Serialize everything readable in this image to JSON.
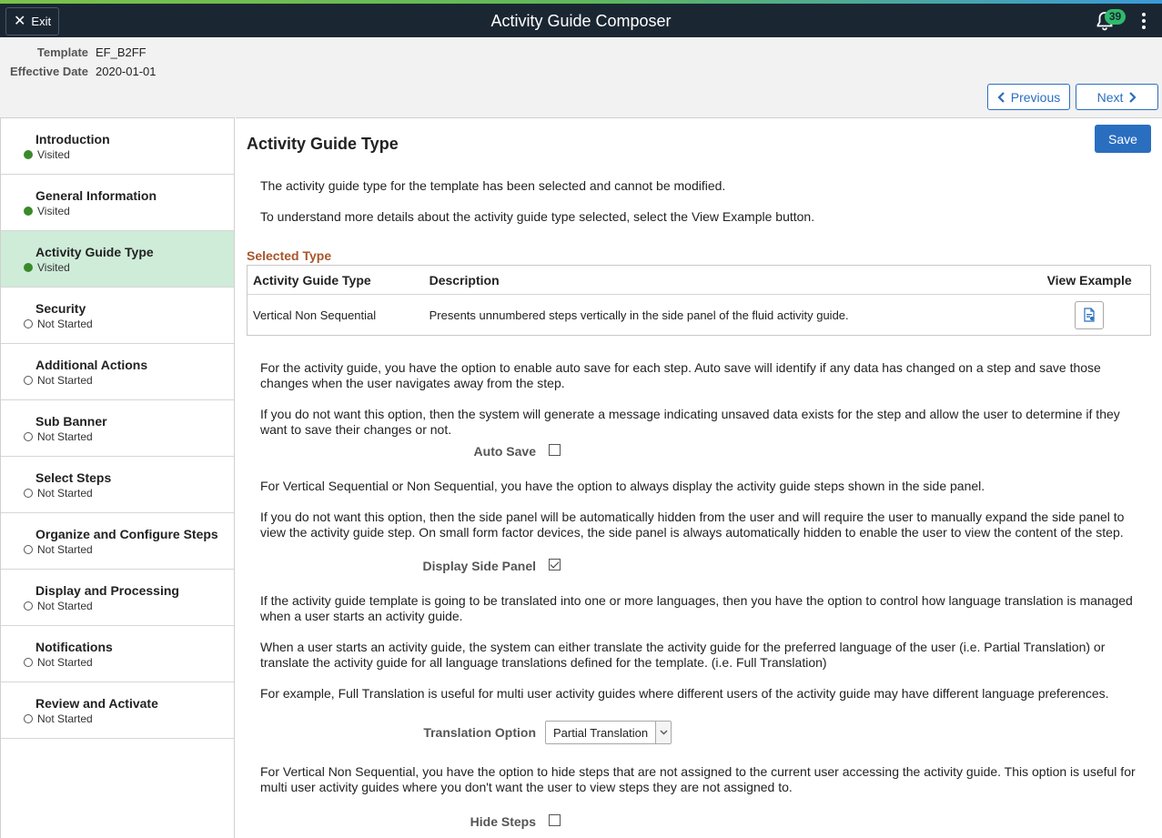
{
  "header": {
    "exit_label": "Exit",
    "title": "Activity Guide Composer",
    "notification_count": "39"
  },
  "subheader": {
    "template_label": "Template",
    "template_value": "EF_B2FF",
    "effective_date_label": "Effective Date",
    "effective_date_value": "2020-01-01",
    "previous_label": "Previous",
    "next_label": "Next"
  },
  "sidebar": {
    "items": [
      {
        "label": "Introduction",
        "status": "Visited"
      },
      {
        "label": "General Information",
        "status": "Visited"
      },
      {
        "label": "Activity Guide Type",
        "status": "Visited"
      },
      {
        "label": "Security",
        "status": "Not Started"
      },
      {
        "label": "Additional Actions",
        "status": "Not Started"
      },
      {
        "label": "Sub Banner",
        "status": "Not Started"
      },
      {
        "label": "Select Steps",
        "status": "Not Started"
      },
      {
        "label": "Organize and Configure Steps",
        "status": "Not Started"
      },
      {
        "label": "Display and Processing",
        "status": "Not Started"
      },
      {
        "label": "Notifications",
        "status": "Not Started"
      },
      {
        "label": "Review and Activate",
        "status": "Not Started"
      }
    ]
  },
  "main": {
    "title": "Activity Guide Type",
    "save_label": "Save",
    "intro1": "The activity guide type for the template has been selected and cannot be modified.",
    "intro2": "To understand more details about the activity guide type selected, select the View Example button.",
    "selected_type_label": "Selected Type",
    "table": {
      "headers": [
        "Activity Guide Type",
        "Description",
        "View Example"
      ],
      "row": {
        "type": "Vertical Non Sequential",
        "description": "Presents unnumbered steps vertically in the side panel of the fluid activity guide."
      }
    },
    "autosave_p1": "For the activity guide, you have the option to enable auto save for each step. Auto save will identify if any data has changed on a step and save those changes when the user navigates away from the step.",
    "autosave_p2": "If you do not want this option, then the system will generate a message indicating unsaved data exists for the step and allow the user to determine if they want to save their changes or not.",
    "autosave_label": "Auto Save",
    "autosave_checked": false,
    "sidepanel_p1": "For Vertical Sequential or Non Sequential, you have the option to always display the activity guide steps shown in the side panel.",
    "sidepanel_p2": "If you do not want this option, then the side panel will be automatically hidden from the user and will require the user to manually expand the side panel to view the activity guide step. On small form factor devices, the side panel is always automatically hidden to enable the user to view the content of the step.",
    "sidepanel_label": "Display Side Panel",
    "sidepanel_checked": true,
    "translation_p1": "If the activity guide template is going to be translated into one or more languages, then you have the option to control how language translation is managed when a user starts an activity guide.",
    "translation_p2": "When a user starts an activity guide, the system can either translate the activity guide for the preferred language of the user (i.e. Partial Translation) or translate the activity guide for all language translations defined for the template. (i.e. Full Translation)",
    "translation_p3": "For example, Full Translation is useful for multi user activity guides where different users of the activity guide may have different language preferences.",
    "translation_label": "Translation Option",
    "translation_value": "Partial Translation",
    "hidesteps_p1": "For Vertical Non Sequential, you have the option to hide steps that are not assigned to the current user accessing the activity guide. This option is useful for multi user activity guides where you don't want the user to view steps they are not assigned to.",
    "hidesteps_label": "Hide Steps",
    "hidesteps_checked": false
  },
  "colors": {
    "header_bg": "#1b2633",
    "accent_blue": "#2a6ec0",
    "visited_green": "#3a8a2c",
    "active_step_bg": "#cfecd9",
    "section_label": "#a8562a",
    "badge_green": "#2fb96c"
  }
}
